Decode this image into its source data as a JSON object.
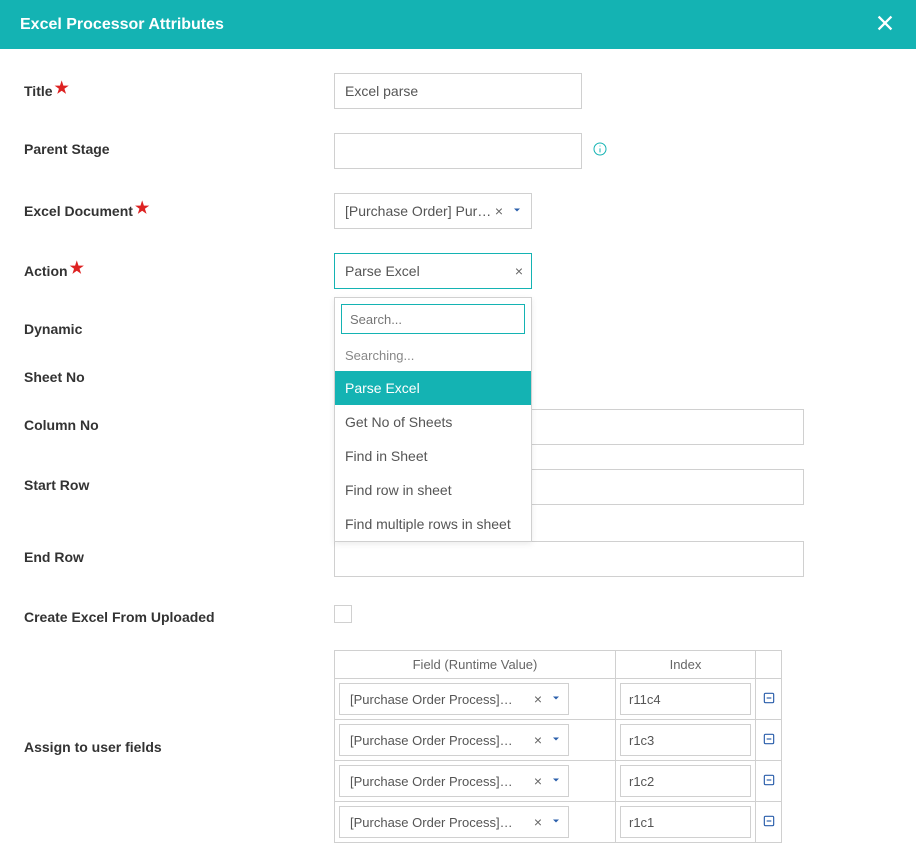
{
  "header": {
    "title": "Excel Processor Attributes"
  },
  "labels": {
    "title": "Title",
    "parent_stage": "Parent Stage",
    "excel_document": "Excel Document",
    "action": "Action",
    "dynamic": "Dynamic",
    "sheet_no": "Sheet No",
    "column_no": "Column No",
    "start_row": "Start Row",
    "end_row": "End Row",
    "create_excel": "Create Excel From Uploaded",
    "assign": "Assign to user fields"
  },
  "values": {
    "title": "Excel parse",
    "excel_document": "[Purchase Order] Purc...",
    "action": "Parse Excel",
    "column_no": "",
    "start_row": "",
    "end_row": ""
  },
  "dropdown": {
    "search_placeholder": "Search...",
    "searching_text": "Searching...",
    "options": [
      "Parse Excel",
      "Get No of Sheets",
      "Find in Sheet",
      "Find row in sheet",
      "Find multiple rows in sheet"
    ]
  },
  "table": {
    "headers": {
      "field": "Field (Runtime Value)",
      "index": "Index"
    },
    "rows": [
      {
        "field": "[Purchase Order Process] To...",
        "index": "r11c4"
      },
      {
        "field": "[Purchase Order Process] U...",
        "index": "r1c3"
      },
      {
        "field": "[Purchase Order Process] Q...",
        "index": "r1c2"
      },
      {
        "field": "[Purchase Order Process] Pr...",
        "index": "r1c1"
      }
    ]
  }
}
